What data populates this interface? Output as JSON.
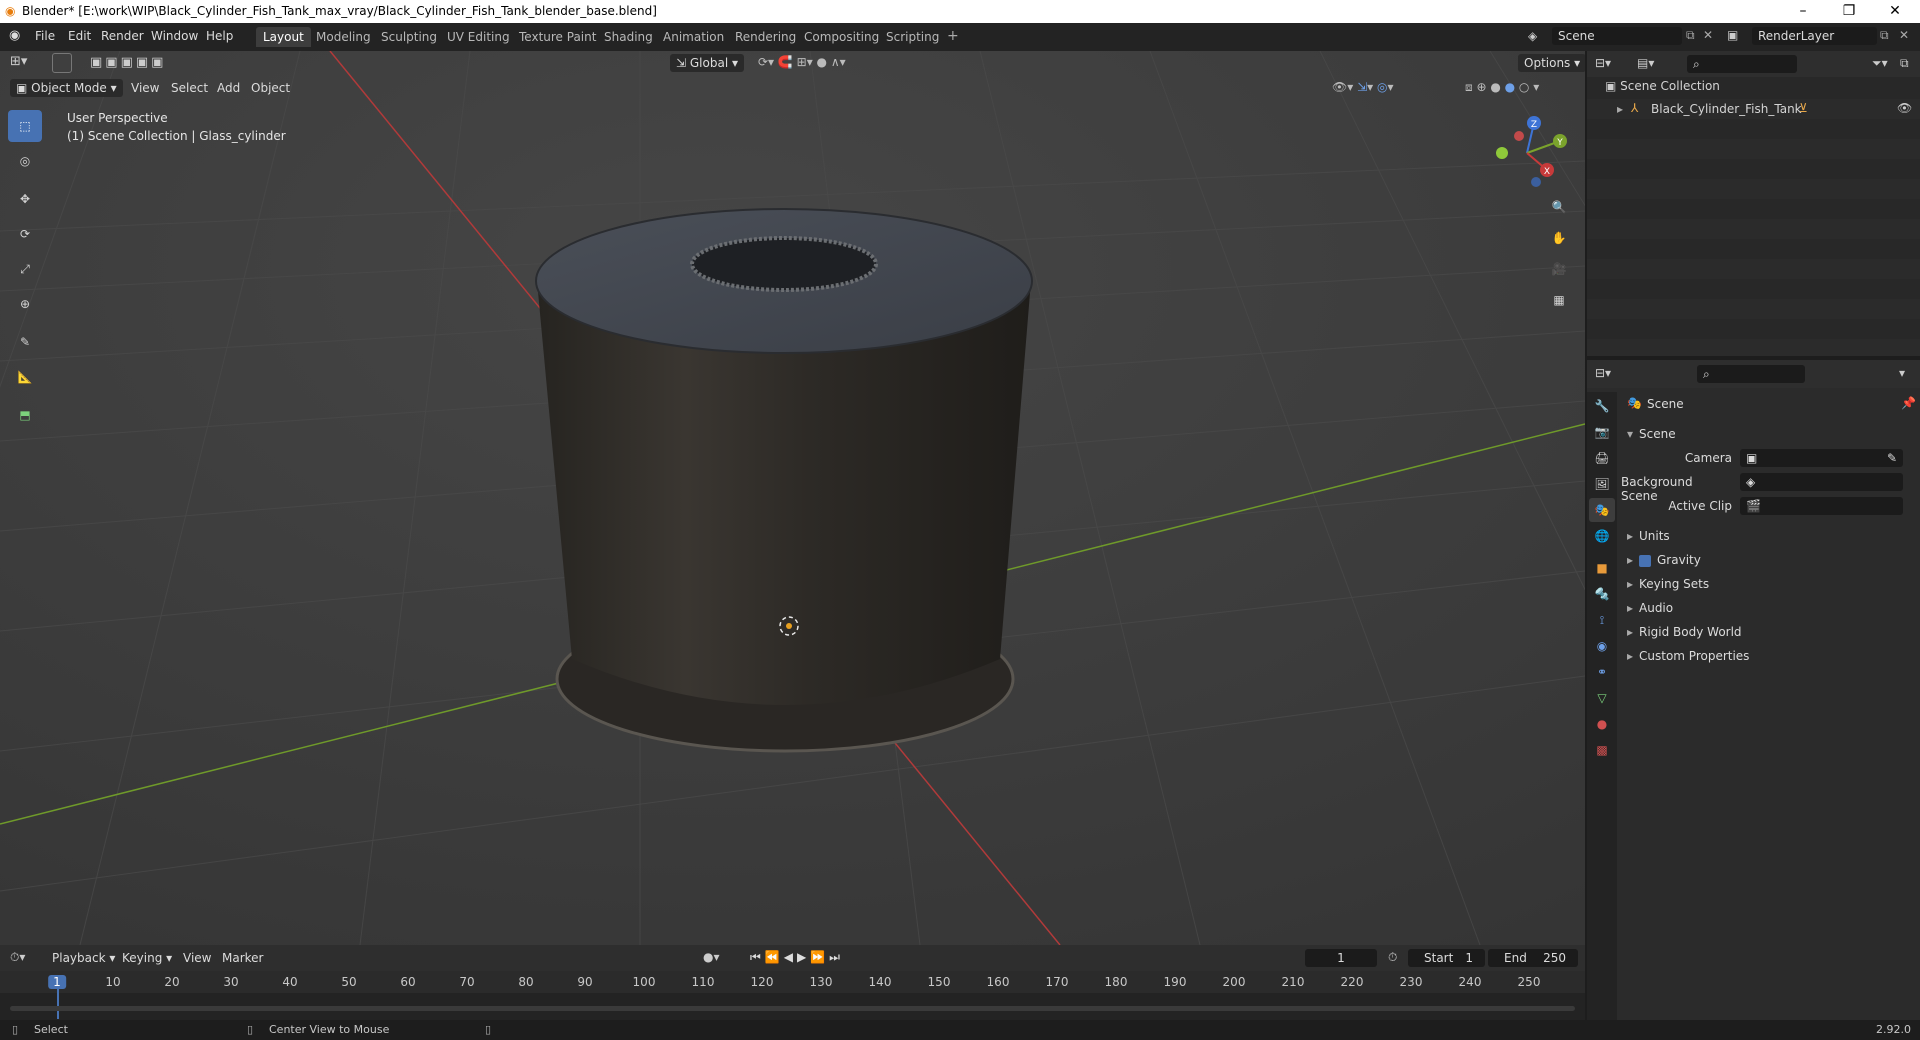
{
  "window": {
    "title": "Blender* [E:\\work\\WIP\\Black_Cylinder_Fish_Tank_max_vray/Black_Cylinder_Fish_Tank_blender_base.blend]"
  },
  "menubar": {
    "file": "File",
    "edit": "Edit",
    "render": "Render",
    "window": "Window",
    "help": "Help",
    "workspaces": [
      "Layout",
      "Modeling",
      "Sculpting",
      "UV Editing",
      "Texture Paint",
      "Shading",
      "Animation",
      "Rendering",
      "Compositing",
      "Scripting"
    ],
    "plus": "+",
    "scene": "Scene",
    "render_layer": "RenderLayer"
  },
  "viewport": {
    "mode": "Object Mode",
    "menu_view": "View",
    "menu_select": "Select",
    "menu_add": "Add",
    "menu_object": "Object",
    "transform_orientation": "Global",
    "options": "Options",
    "info_line1": "User Perspective",
    "info_line2": "(1) Scene Collection | Glass_cylinder",
    "gizmo_x": "X",
    "gizmo_y": "Y",
    "gizmo_z": "Z"
  },
  "outliner": {
    "root": "Scene Collection",
    "item": "Black_Cylinder_Fish_Tank"
  },
  "properties": {
    "context": "Scene",
    "panel": "Scene",
    "camera_label": "Camera",
    "bg_scene_label": "Background Scene",
    "active_clip_label": "Active Clip",
    "sections": [
      "Units",
      "Gravity",
      "Keying Sets",
      "Audio",
      "Rigid Body World",
      "Custom Properties"
    ],
    "gravity_checked": true
  },
  "timeline": {
    "playback": "Playback",
    "keying": "Keying",
    "view": "View",
    "marker": "Marker",
    "current_frame": "1",
    "start_label": "Start",
    "start": "1",
    "end_label": "End",
    "end": "250",
    "ruler": [
      "1",
      "10",
      "20",
      "30",
      "40",
      "50",
      "60",
      "70",
      "80",
      "90",
      "100",
      "110",
      "120",
      "130",
      "140",
      "150",
      "160",
      "170",
      "180",
      "190",
      "200",
      "210",
      "220",
      "230",
      "240",
      "250"
    ]
  },
  "statusbar": {
    "select": "Select",
    "center_view": "Center View to Mouse",
    "version": "2.92.0"
  },
  "colors": {
    "accent": "#4772b3",
    "x_axis": "#c73a3a",
    "y_axis": "#7ba32c",
    "z_axis": "#3e74d6"
  }
}
